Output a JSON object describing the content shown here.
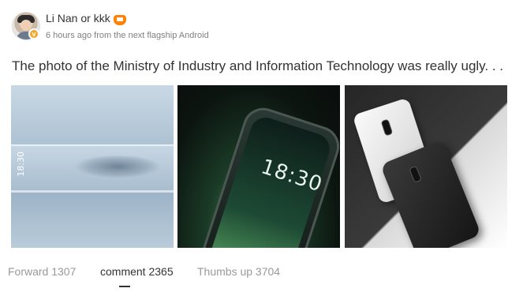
{
  "post": {
    "username": "Li Nan or kkk",
    "time": "6 hours ago",
    "source": "from the next flagship Android",
    "content": "The photo of the Ministry of Industry and Information Technology was really ugly. . .",
    "photos": [
      {
        "screen_text": "18:30"
      },
      {
        "screen_text": "18:30"
      },
      {
        "screen_text": ""
      }
    ]
  },
  "actions": {
    "forward": "Forward 1307",
    "comment": "comment 2365",
    "likes": "Thumbs up 3704"
  },
  "icons": {
    "avatar": "user-avatar",
    "verified": "verified-badge-icon",
    "vip": "vip-crown-icon"
  },
  "colors": {
    "accent": "#ff8200",
    "verified": "#f5a623",
    "meta_text": "#808080"
  }
}
